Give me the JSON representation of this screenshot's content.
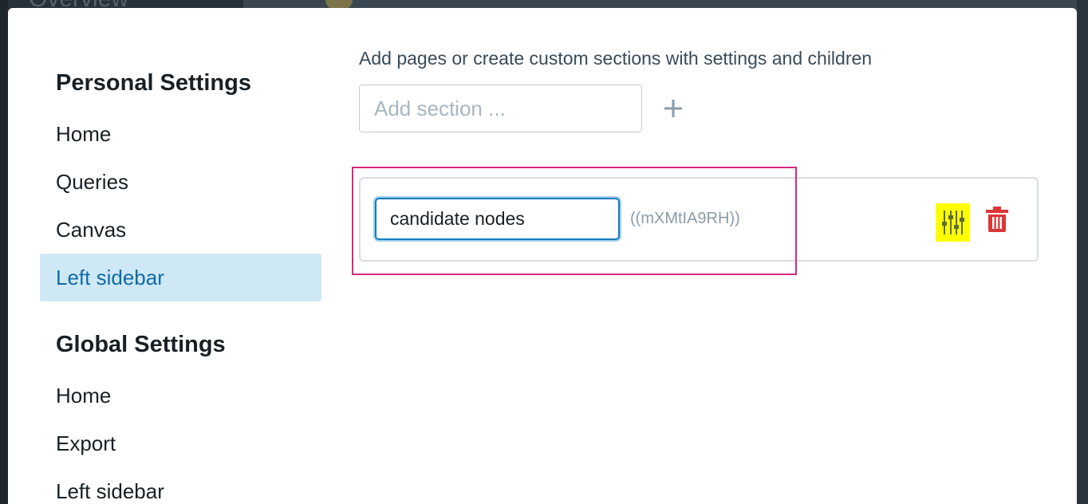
{
  "background": {
    "top_text": "Overview"
  },
  "nav": {
    "personal_heading": "Personal Settings",
    "personal_items": [
      {
        "label": "Home",
        "active": false
      },
      {
        "label": "Queries",
        "active": false
      },
      {
        "label": "Canvas",
        "active": false
      },
      {
        "label": "Left sidebar",
        "active": true
      }
    ],
    "global_heading": "Global Settings",
    "global_items": [
      {
        "label": "Home"
      },
      {
        "label": "Export"
      },
      {
        "label": "Left sidebar"
      }
    ]
  },
  "main": {
    "description": "Add pages or create custom sections with settings and children",
    "add_section": {
      "placeholder": "Add section ...",
      "value": "",
      "add_icon": "plus-icon"
    },
    "sections": [
      {
        "name": "candidate nodes",
        "uid": "((mXMtIA9RH))",
        "settings_icon": "sliders-icon",
        "delete_icon": "trash-icon"
      }
    ]
  },
  "colors": {
    "accent": "#137cbd",
    "active_nav_bg": "#cfe8f5",
    "active_nav_text": "#106ba3",
    "danger": "#db3737",
    "highlight": "#ffff00",
    "annotation_border": "#d8287f"
  }
}
